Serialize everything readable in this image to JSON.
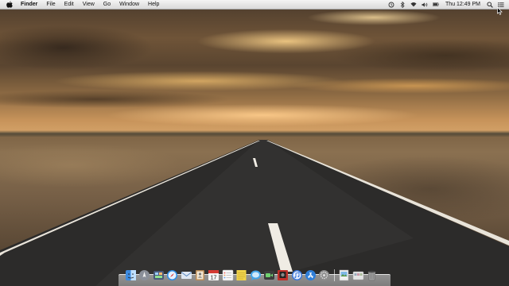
{
  "menubar": {
    "app_name": "Finder",
    "menus": [
      "File",
      "Edit",
      "View",
      "Go",
      "Window",
      "Help"
    ],
    "status_icons": [
      "time-machine-icon",
      "bluetooth-icon",
      "wifi-icon",
      "volume-icon",
      "battery-icon"
    ],
    "clock": "Thu 12:49 PM",
    "spotlight_icon": "spotlight-search-icon",
    "notification_icon": "notification-center-icon"
  },
  "desktop": {
    "wallpaper": "desert-road-sunset"
  },
  "dock": {
    "items": [
      {
        "name": "finder",
        "color": "#3d8be0"
      },
      {
        "name": "launchpad",
        "color": "#8a8f99"
      },
      {
        "name": "mission-control",
        "color": "#4a5a7a"
      },
      {
        "name": "safari",
        "color": "#2f8de4"
      },
      {
        "name": "mail",
        "color": "#5b88c0"
      },
      {
        "name": "contacts",
        "color": "#b88a55"
      },
      {
        "name": "calendar",
        "color": "#e8e8e8"
      },
      {
        "name": "reminders",
        "color": "#f2f2f2"
      },
      {
        "name": "notes",
        "color": "#f0d34a"
      },
      {
        "name": "messages",
        "color": "#43a4e8"
      },
      {
        "name": "facetime",
        "color": "#3c3c3c"
      },
      {
        "name": "photo-booth",
        "color": "#c0302a"
      },
      {
        "name": "itunes",
        "color": "#3c78d8"
      },
      {
        "name": "app-store",
        "color": "#2f7ed8"
      },
      {
        "name": "system-preferences",
        "color": "#8c8c8c"
      },
      {
        "name": "preview",
        "color": "#f0f0f0"
      },
      {
        "name": "downloads",
        "color": "#e4e4e4"
      },
      {
        "name": "trash",
        "color": "#9a9a9a"
      }
    ]
  }
}
